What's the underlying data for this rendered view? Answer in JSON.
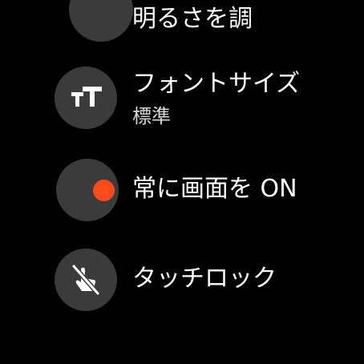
{
  "settings": {
    "items": [
      {
        "id": "brightness",
        "title": "明るさを調",
        "icon": "brightness-icon"
      },
      {
        "id": "font-size",
        "title": "フォントサイズ",
        "subtitle": "標準",
        "icon": "text-size-icon"
      },
      {
        "id": "always-on",
        "title": "常に画面を ON",
        "icon": "toggle-icon",
        "toggle_on": true
      },
      {
        "id": "touch-lock",
        "title": "タッチロック",
        "icon": "touch-lock-icon"
      }
    ]
  },
  "colors": {
    "background": "#000000",
    "icon_circle": "#3b3b3b",
    "accent": "#ff4a1c",
    "text_primary": "#ffffff",
    "text_secondary": "#d8d8d8"
  }
}
